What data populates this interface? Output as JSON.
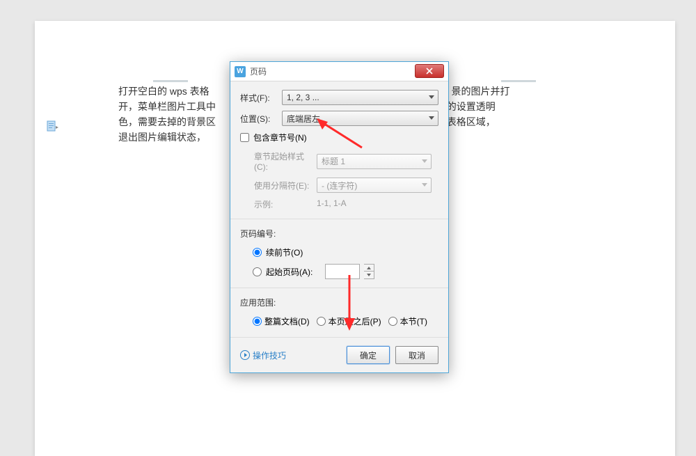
{
  "document": {
    "line1": "打开空白的 wps 表格",
    "line1_tail": "景的图片并打",
    "line2_head": "开，菜单栏图片工具中",
    "line2_tail": "下的设置透明",
    "line3_head": "色，需要去掉的背景区",
    "line3_tail": "的表格区域，",
    "line4": "退出图片编辑状态，"
  },
  "dialog": {
    "title": "页码",
    "style_label": "样式(F):",
    "style_value": "1, 2, 3 ...",
    "position_label": "位置(S):",
    "position_value": "底端居左",
    "include_chapter_label": "包含章节号(N)",
    "chapter_start_label": "章节起始样式(C):",
    "chapter_start_value": "标题 1",
    "separator_label": "使用分隔符(E):",
    "separator_value": "-   (连字符)",
    "example_label": "示例:",
    "example_value": "1-1, 1-A",
    "numbering_title": "页码编号:",
    "continue_label": "续前节(O)",
    "start_at_label": "起始页码(A):",
    "scope_title": "应用范围:",
    "whole_doc_label": "整篇文档(D)",
    "from_page_label": "本页及之后(P)",
    "this_section_label": "本节(T)",
    "tips_label": "操作技巧",
    "ok_label": "确定",
    "cancel_label": "取消"
  }
}
